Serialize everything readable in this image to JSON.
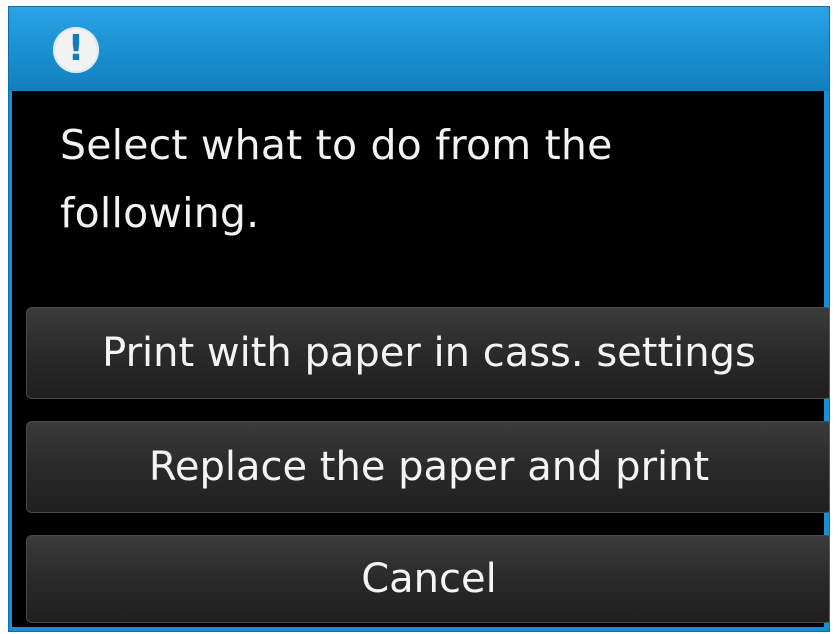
{
  "dialog": {
    "icon": "exclamation-icon",
    "message": "Select what to do from the following."
  },
  "options": [
    {
      "label": "Print with paper in cass. settings"
    },
    {
      "label": "Replace the paper and print"
    },
    {
      "label": "Cancel"
    }
  ],
  "colors": {
    "header": "#1a8fd0",
    "background": "#000000",
    "button": "#2a2a2a",
    "text": "#f2f2f2"
  }
}
